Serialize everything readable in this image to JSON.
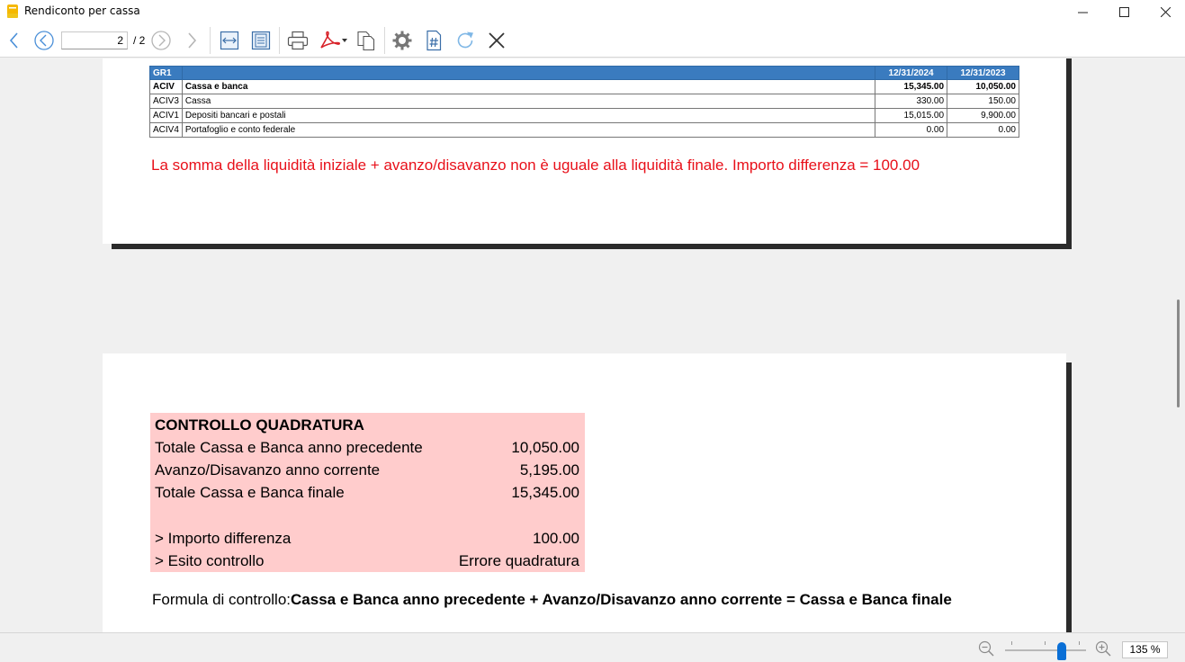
{
  "window": {
    "title": "Rendiconto per cassa"
  },
  "toolbar": {
    "page_value": "2",
    "page_total": "/ 2",
    "icons": [
      "back-arrow-icon",
      "prev-page-icon",
      "next-page-icon",
      "forward-arrow-icon",
      "fit-width-icon",
      "fit-page-icon",
      "print-icon",
      "pdf-icon",
      "copy-icon",
      "settings-icon",
      "hashtag-icon",
      "refresh-icon",
      "close-icon"
    ]
  },
  "page1": {
    "table": {
      "header": [
        "GR1",
        "",
        "12/31/2024",
        "12/31/2023"
      ],
      "rows": [
        {
          "code": "ACIV",
          "desc": "Cassa e banca",
          "v2024": "15,345.00",
          "v2023": "10,050.00",
          "bold": true
        },
        {
          "code": "ACIV3",
          "desc": "Cassa",
          "v2024": "330.00",
          "v2023": "150.00"
        },
        {
          "code": "ACIV1",
          "desc": "Depositi bancari e postali",
          "v2024": "15,015.00",
          "v2023": "9,900.00"
        },
        {
          "code": "ACIV4",
          "desc": "Portafoglio e conto federale",
          "v2024": "0.00",
          "v2023": "0.00"
        }
      ]
    },
    "warning": "La somma della liquidità iniziale + avanzo/disavanzo non è uguale alla liquidità finale. Importo differenza = 100.00",
    "colors": {
      "warning": "#e8101a",
      "header": "#3a7bbf"
    }
  },
  "page2": {
    "box_title": "CONTROLLO QUADRATURA",
    "rows": [
      {
        "label": "Totale Cassa e Banca anno precedente",
        "value": "10,050.00"
      },
      {
        "label": "Avanzo/Disavanzo anno corrente",
        "value": "5,195.00"
      },
      {
        "label": "Totale Cassa e Banca finale",
        "value": "15,345.00"
      },
      {
        "label": "> Importo differenza",
        "value": "100.00"
      },
      {
        "label": "> Esito controllo",
        "value": "Errore quadratura"
      }
    ],
    "formula_label": "Formula di controllo:",
    "formula_text": "Cassa e Banca anno precedente + Avanzo/Disavanzo anno corrente = Cassa e Banca finale",
    "colors": {
      "box": "#ffcccc"
    }
  },
  "statusbar": {
    "zoom": "135 %",
    "zoom_level_percent": 135
  }
}
